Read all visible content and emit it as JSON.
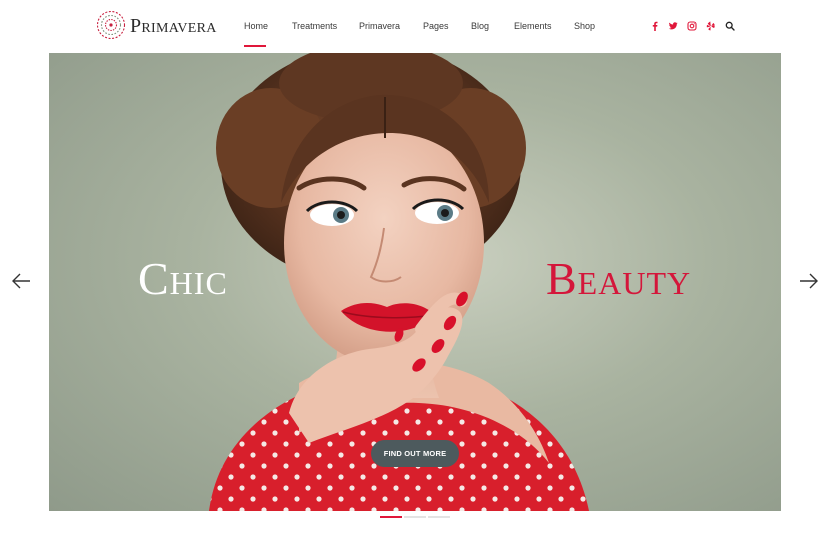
{
  "header": {
    "brand": "Primavera",
    "nav": [
      {
        "label": "Home",
        "active": true
      },
      {
        "label": "Treatments"
      },
      {
        "label": "Primavera"
      },
      {
        "label": "Pages"
      },
      {
        "label": "Blog"
      },
      {
        "label": "Elements"
      },
      {
        "label": "Shop"
      }
    ],
    "social_icons": [
      "facebook-icon",
      "twitter-icon",
      "instagram-icon",
      "yelp-icon"
    ],
    "search_icon": "search-icon"
  },
  "hero": {
    "word_left": "Chic",
    "word_right": "Beauty",
    "cta_label": "FIND OUT MORE",
    "accent_color": "#e0173a",
    "slides": 3,
    "active_slide": 1
  }
}
